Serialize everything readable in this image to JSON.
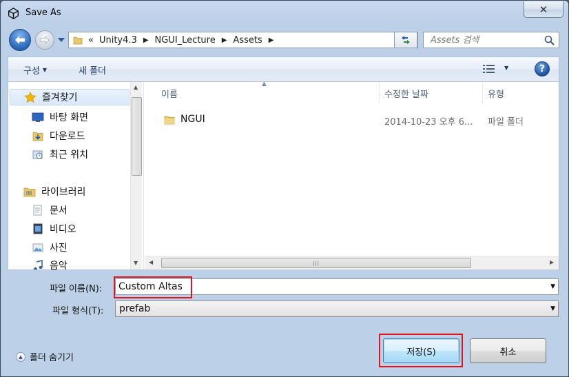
{
  "window": {
    "title": "Save As",
    "close_symbol": "✕"
  },
  "address": {
    "overflow": "«",
    "crumbs": [
      "Unity4.3",
      "NGUI_Lecture",
      "Assets"
    ],
    "separator": "▶"
  },
  "search": {
    "placeholder": "Assets 검색"
  },
  "toolbar": {
    "organize": "구성",
    "new_folder": "새 폴더",
    "help": "?"
  },
  "nav": {
    "favorites": "즐겨찾기",
    "desktop": "바탕 화면",
    "downloads": "다운로드",
    "recent": "최근 위치",
    "libraries": "라이브러리",
    "documents": "문서",
    "videos": "비디오",
    "pictures": "사진",
    "music": "음악"
  },
  "columns": {
    "name": "이름",
    "date": "수정한 날짜",
    "type": "유형"
  },
  "files": [
    {
      "name": "NGUI",
      "date": "2014-10-23 오후 6...",
      "type": "파일 폴더"
    }
  ],
  "form": {
    "filename_label": "파일 이름(N):",
    "filename_value": "Custom Altas",
    "filetype_label": "파일 형식(T):",
    "filetype_value": "prefab"
  },
  "footer": {
    "hide_folders": "폴더 숨기기",
    "save": "저장(S)",
    "cancel": "취소"
  },
  "colors": {
    "highlight": "#e0121a",
    "accent": "#2f6cbc"
  }
}
